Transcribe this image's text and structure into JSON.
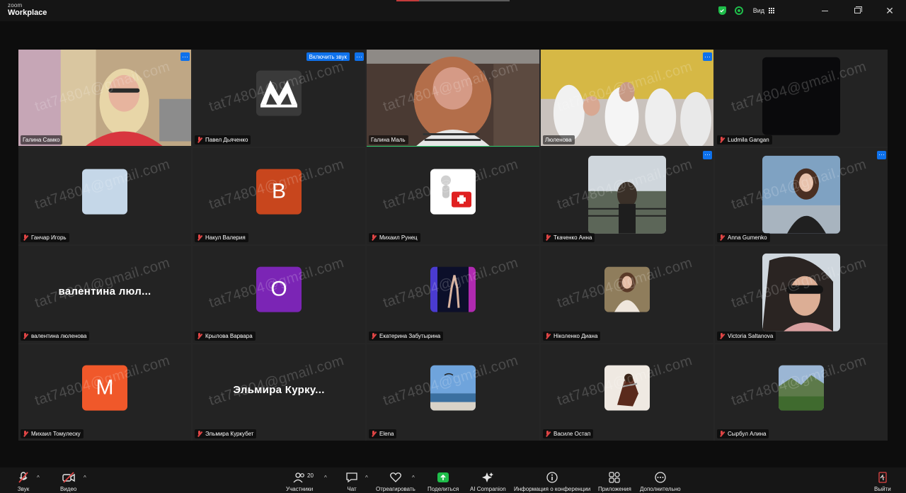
{
  "app": {
    "brand_top": "zoom",
    "brand_bottom": "Workplace"
  },
  "topbar": {
    "view_label": "Вид"
  },
  "watermark": "tat74804@gmail.com",
  "tiles": [
    {
      "name": "Галина Самко",
      "more": true
    },
    {
      "name": "Павел Дьяченко",
      "more": true,
      "unmute": "Включить звук"
    },
    {
      "name": "Галина Маль",
      "active": true
    },
    {
      "name": "Люленова",
      "more": true
    },
    {
      "name": "Ludmila Gangan"
    },
    {
      "name": "Ганчар Игорь"
    },
    {
      "name": "Накул Валерия",
      "avatar_letter": "B",
      "avatar_color": "#c8461d"
    },
    {
      "name": "Михаил Рунец"
    },
    {
      "name": "Ткаченко Анна",
      "more": true
    },
    {
      "name": "Anna Gumenko",
      "more": true
    },
    {
      "name": "валентина люленова",
      "display": "валентина  люл..."
    },
    {
      "name": "Крылова Варвара",
      "avatar_letter": "O",
      "avatar_color": "#7b25b5"
    },
    {
      "name": "Екатерина Забутырина"
    },
    {
      "name": "Ніколенко Диана"
    },
    {
      "name": "Victoria Saltanova"
    },
    {
      "name": "Михаил Томулеску",
      "avatar_letter": "M",
      "avatar_color": "#f0582a"
    },
    {
      "name": "Эльмира Куркубет",
      "display": "Эльмира  Курку..."
    },
    {
      "name": "Elena"
    },
    {
      "name": "Василе Остап"
    },
    {
      "name": "Сырбул Алина"
    }
  ],
  "toolbar": {
    "audio": "Звук",
    "video": "Видео",
    "participants": "Участники",
    "participants_count": "20",
    "chat": "Чат",
    "react": "Отреагировать",
    "share": "Поделиться",
    "ai": "AI Companion",
    "info": "Информация о конференции",
    "apps": "Приложения",
    "more": "Дополнительно",
    "leave": "Выйти"
  },
  "colors": {
    "accent": "#0e71eb",
    "active_speaker": "#2fcb6d",
    "muted": "#e04545",
    "share": "#1fbd4a",
    "leave": "#e04545"
  }
}
